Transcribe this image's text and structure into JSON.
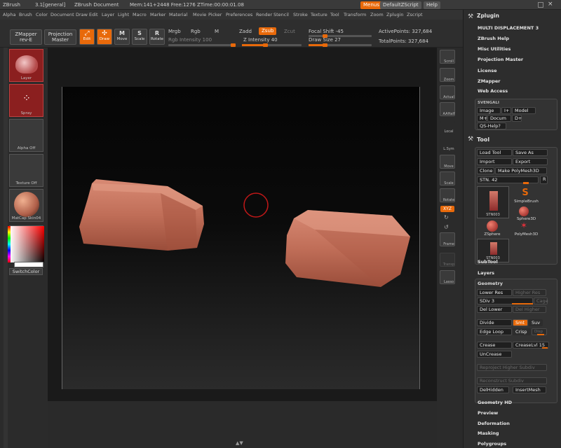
{
  "titlebar": {
    "app": "ZBrush",
    "version": "3.1[general]",
    "doc": "ZBrush Document",
    "mem": "Mem:141+2448 Free:1276 ZTime:00:00:01.08",
    "menus_btn": "Menus",
    "script_btn": "DefaultZScript",
    "help_btn": "Help"
  },
  "menubar": [
    "Alpha",
    "Brush",
    "Color",
    "Document",
    "Draw",
    "Edit",
    "Layer",
    "Light",
    "Macro",
    "Marker",
    "Material",
    "Movie",
    "Picker",
    "Preferences",
    "Render",
    "Stencil",
    "Stroke",
    "Texture",
    "Tool",
    "Transform",
    "Zoom",
    "Zplugin",
    "Zscript"
  ],
  "shelf": {
    "zmapper": "ZMapper",
    "zmapper2": "rev-E",
    "projection": "Projection",
    "projection2": "Master",
    "edit": "Edit",
    "draw": "Draw",
    "move": "Move",
    "scale": "Scale",
    "rotate": "Rotate",
    "mrgb": "Mrgb",
    "rgb": "Rgb",
    "m": "M",
    "rgb_intensity": "Rgb Intensity 100",
    "zadd": "Zadd",
    "zsub": "Zsub",
    "zcut": "Zcut",
    "z_intensity": "Z Intensity 40",
    "focal_shift": "Focal Shift -45",
    "draw_size": "Draw Size 27",
    "active_points": "ActivePoints: 327,684",
    "total_points": "TotalPoints: 327,684"
  },
  "leftpal": {
    "brush_label": "Layer",
    "stroke_label": "Spray",
    "alpha_label": "Alpha Off",
    "texture_label": "Texture Off",
    "material_label": "MatCap Skin04",
    "switch_color": "SwitchColor"
  },
  "rightshelf": [
    "Scroll",
    "Zoom",
    "Actual",
    "AAHalf",
    "Local",
    "L.Sym",
    "Move",
    "Scale",
    "Rotate",
    "XYZ",
    "Frame",
    "Transp",
    "Lasso"
  ],
  "zplugin": {
    "title": "Zplugin",
    "items": [
      "MULTI DISPLACEMENT 3",
      "ZBrush Help",
      "Misc Utilities",
      "Projection Master",
      "License",
      "ZMapper",
      "Web Access"
    ],
    "svengali": "SVENGALI",
    "image_btn": "Image",
    "iplus_btn": "I+",
    "model_btn": "Model",
    "mplus_btn": "M+",
    "docum_btn": "Docum",
    "dplus_btn": "D+",
    "qs_btn": "QS-Help?"
  },
  "tool": {
    "title": "Tool",
    "load": "Load Tool",
    "save": "Save As",
    "import": "Import",
    "export": "Export",
    "clone": "Clone",
    "make_polymesh": "Make PolyMesh3D",
    "stn": "STN. 42",
    "r_btn": "R",
    "thumbs": [
      "STN003",
      "SimpleBrush",
      "ZSphere",
      "Sphere3D",
      "PolyMesh3D",
      "STN003"
    ],
    "subtool": "SubTool",
    "layers": "Layers",
    "geometry": "Geometry",
    "lower_res": "Lower Res",
    "higher_res": "Higher Res",
    "sdiv": "SDiv 3",
    "cage": "Cage",
    "del_lower": "Del Lower",
    "del_higher": "Del Higher",
    "divide": "Divide",
    "smt": "Smt",
    "suv": "Suv",
    "edge_loop": "Edge Loop",
    "crisp": "Crisp",
    "disp": "Disp",
    "crease": "Crease",
    "crease_lvl": "CreaseLvl 15",
    "uncrease": "UnCrease",
    "reproject": "Reproject Higher Subdiv",
    "reconstruct": "Reconstruct Subdiv",
    "delhidden": "DelHidden",
    "insertmesh": "InsertMesh",
    "geometry_hd": "Geometry HD",
    "preview": "Preview",
    "deformation": "Deformation",
    "masking": "Masking",
    "polygroups": "Polygroups"
  },
  "colors": {
    "accent": "#e8690a",
    "brick": "#c8715e",
    "active_red": "#8b1f1f"
  }
}
